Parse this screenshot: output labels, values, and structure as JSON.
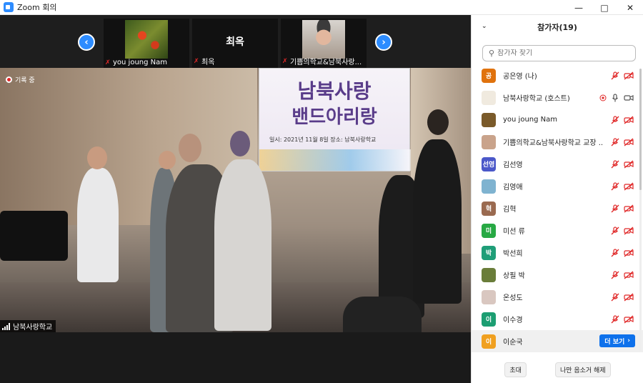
{
  "window": {
    "title": "Zoom 회의"
  },
  "thumbnails": [
    {
      "name": "you joung Nam",
      "has_video": true
    },
    {
      "name": "최옥",
      "has_video": false,
      "display_name": "최옥"
    },
    {
      "name": "기쁨의학교&남북사랑...",
      "has_video": true
    }
  ],
  "main_video": {
    "recording_label": "기록 중",
    "speaker_name": "남북사랑학교",
    "banner_line1": "남북사랑",
    "banner_line2": "밴드아리랑",
    "banner_line3": "일시: 2021년 11월 8일   장소: 남북사랑학교"
  },
  "panel": {
    "title": "참가자(19)",
    "search_placeholder": "참가자 찾기",
    "more_label": "더 보기",
    "invite_label": "초대",
    "unmute_label": "나만 음소거 해제",
    "participants": [
      {
        "initial": "공",
        "name": "공은영 (나)",
        "color": "#e0720d",
        "mic": "muted",
        "cam": "off"
      },
      {
        "initial": "",
        "name": "남북사랑학교 (호스트)",
        "color": "#f0eadf",
        "mic": "on",
        "cam": "on",
        "rec": true
      },
      {
        "initial": "",
        "name": "you joung Nam",
        "color": "#7a5a2a",
        "mic": "muted",
        "cam": "off"
      },
      {
        "initial": "",
        "name": "기쁨의학교&남북사랑학교 교장 ...",
        "color": "#c9a38b",
        "mic": "muted",
        "cam": "off"
      },
      {
        "initial": "선영",
        "name": "김선영",
        "color": "#4b58c9",
        "mic": "muted",
        "cam": "off"
      },
      {
        "initial": "",
        "name": "김영애",
        "color": "#7fb3d0",
        "mic": "muted",
        "cam": "off"
      },
      {
        "initial": "혁",
        "name": "김혁",
        "color": "#9a6a50",
        "mic": "muted",
        "cam": "off"
      },
      {
        "initial": "미",
        "name": "미선 류",
        "color": "#27a944",
        "mic": "muted",
        "cam": "off"
      },
      {
        "initial": "박",
        "name": "박선희",
        "color": "#1f9e78",
        "mic": "muted",
        "cam": "off"
      },
      {
        "initial": "",
        "name": "상필 박",
        "color": "#6a7d3a",
        "mic": "muted",
        "cam": "off"
      },
      {
        "initial": "",
        "name": "온성도",
        "color": "#d9c7c0",
        "mic": "muted",
        "cam": "off"
      },
      {
        "initial": "이",
        "name": "이수경",
        "color": "#1c9e72",
        "mic": "muted",
        "cam": "off"
      },
      {
        "initial": "이",
        "name": "이순국",
        "color": "#f0a020",
        "mic": "",
        "cam": "",
        "hover": true
      }
    ]
  },
  "colors": {
    "accent": "#2d8cff",
    "muted_red": "#e02828",
    "more_button": "#0e71eb"
  }
}
